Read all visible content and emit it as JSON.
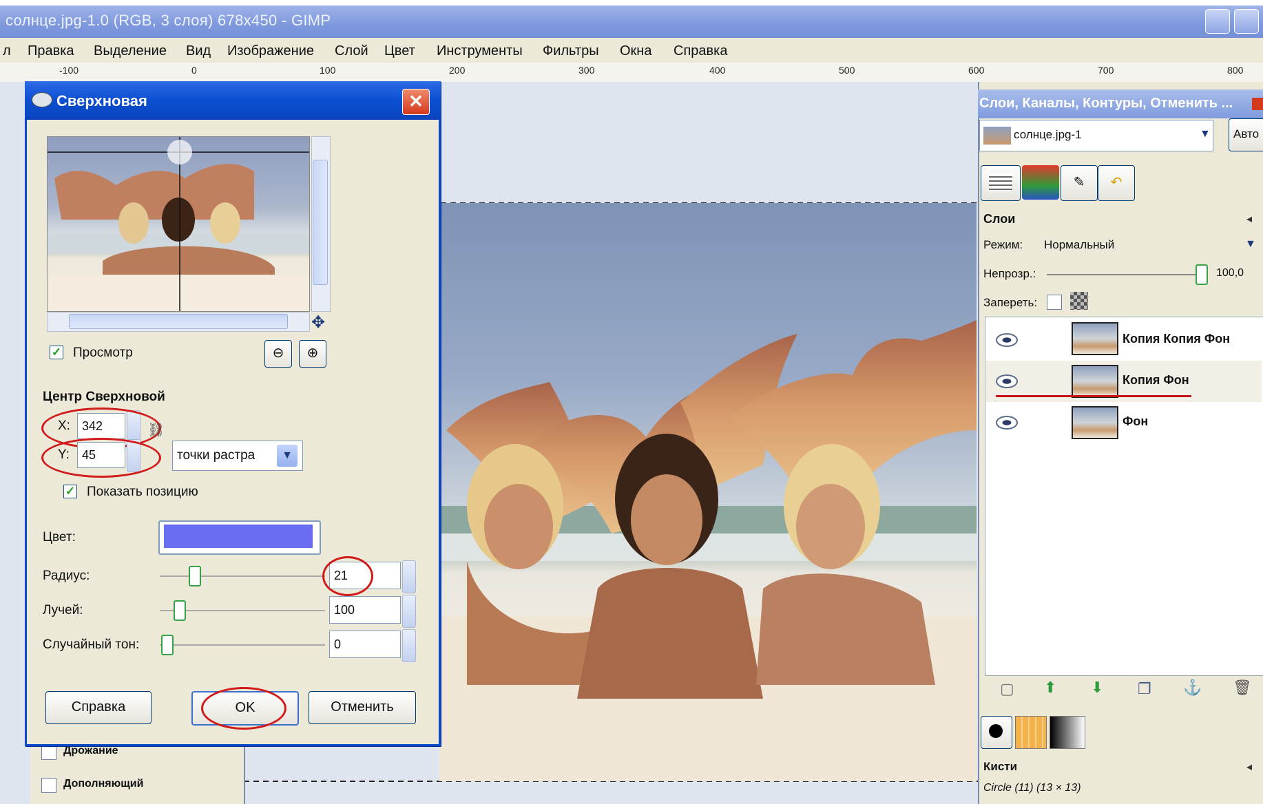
{
  "window": {
    "title": "солнце.jpg-1.0 (RGB, 3 слоя) 678x450 - GIMP"
  },
  "menubar": {
    "items": [
      "л",
      "Правка",
      "Выделение",
      "Вид",
      "Изображение",
      "Слой",
      "Цвет",
      "Инструменты",
      "Фильтры",
      "Окна",
      "Справка"
    ]
  },
  "ruler": {
    "labels": [
      "-100",
      "0",
      "100",
      "200",
      "300",
      "400",
      "500",
      "600",
      "700",
      "800"
    ]
  },
  "dialog": {
    "title": "Сверхновая",
    "preview_label": "Просмотр",
    "preview_checked": true,
    "center_heading": "Центр Сверхновой",
    "x_label": "X:",
    "x_value": "342",
    "y_label": "Y:",
    "y_value": "45",
    "unit_select": "точки растра",
    "show_position_label": "Показать позицию",
    "show_position_checked": true,
    "color_label": "Цвет:",
    "color_value": "#6a6cf2",
    "radius_label": "Радиус:",
    "radius_value": "21",
    "rays_label": "Лучей:",
    "rays_value": "100",
    "random_hue_label": "Случайный тон:",
    "random_hue_value": "0",
    "help_button": "Справка",
    "ok_button": "OK",
    "cancel_button": "Отменить"
  },
  "left_dock": {
    "items": [
      "Дрожание",
      "Дополняющий"
    ]
  },
  "right_panel": {
    "title": "Слои, Каналы, Контуры, Отменить ...",
    "image_select": "солнце.jpg-1",
    "auto_button": "Авто",
    "layers_heading": "Слои",
    "mode_label": "Режим:",
    "mode_value": "Нормальный",
    "opacity_label": "Непрозр.:",
    "opacity_value": "100,0",
    "lock_label": "Запереть:",
    "layers": [
      "Копия Копия Фон",
      "Копия Фон",
      "Фон"
    ],
    "brushes_heading": "Кисти",
    "brush_name": "Circle (11) (13 × 13)"
  }
}
